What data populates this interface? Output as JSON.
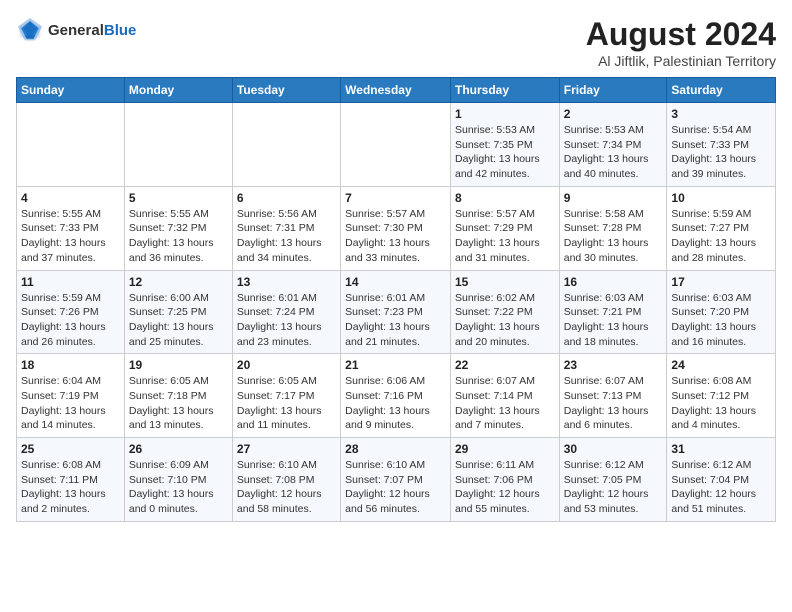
{
  "logo": {
    "text_general": "General",
    "text_blue": "Blue"
  },
  "title": "August 2024",
  "subtitle": "Al Jiftlik, Palestinian Territory",
  "days_of_week": [
    "Sunday",
    "Monday",
    "Tuesday",
    "Wednesday",
    "Thursday",
    "Friday",
    "Saturday"
  ],
  "weeks": [
    [
      {
        "day": "",
        "info": ""
      },
      {
        "day": "",
        "info": ""
      },
      {
        "day": "",
        "info": ""
      },
      {
        "day": "",
        "info": ""
      },
      {
        "day": "1",
        "info": "Sunrise: 5:53 AM\nSunset: 7:35 PM\nDaylight: 13 hours\nand 42 minutes."
      },
      {
        "day": "2",
        "info": "Sunrise: 5:53 AM\nSunset: 7:34 PM\nDaylight: 13 hours\nand 40 minutes."
      },
      {
        "day": "3",
        "info": "Sunrise: 5:54 AM\nSunset: 7:33 PM\nDaylight: 13 hours\nand 39 minutes."
      }
    ],
    [
      {
        "day": "4",
        "info": "Sunrise: 5:55 AM\nSunset: 7:33 PM\nDaylight: 13 hours\nand 37 minutes."
      },
      {
        "day": "5",
        "info": "Sunrise: 5:55 AM\nSunset: 7:32 PM\nDaylight: 13 hours\nand 36 minutes."
      },
      {
        "day": "6",
        "info": "Sunrise: 5:56 AM\nSunset: 7:31 PM\nDaylight: 13 hours\nand 34 minutes."
      },
      {
        "day": "7",
        "info": "Sunrise: 5:57 AM\nSunset: 7:30 PM\nDaylight: 13 hours\nand 33 minutes."
      },
      {
        "day": "8",
        "info": "Sunrise: 5:57 AM\nSunset: 7:29 PM\nDaylight: 13 hours\nand 31 minutes."
      },
      {
        "day": "9",
        "info": "Sunrise: 5:58 AM\nSunset: 7:28 PM\nDaylight: 13 hours\nand 30 minutes."
      },
      {
        "day": "10",
        "info": "Sunrise: 5:59 AM\nSunset: 7:27 PM\nDaylight: 13 hours\nand 28 minutes."
      }
    ],
    [
      {
        "day": "11",
        "info": "Sunrise: 5:59 AM\nSunset: 7:26 PM\nDaylight: 13 hours\nand 26 minutes."
      },
      {
        "day": "12",
        "info": "Sunrise: 6:00 AM\nSunset: 7:25 PM\nDaylight: 13 hours\nand 25 minutes."
      },
      {
        "day": "13",
        "info": "Sunrise: 6:01 AM\nSunset: 7:24 PM\nDaylight: 13 hours\nand 23 minutes."
      },
      {
        "day": "14",
        "info": "Sunrise: 6:01 AM\nSunset: 7:23 PM\nDaylight: 13 hours\nand 21 minutes."
      },
      {
        "day": "15",
        "info": "Sunrise: 6:02 AM\nSunset: 7:22 PM\nDaylight: 13 hours\nand 20 minutes."
      },
      {
        "day": "16",
        "info": "Sunrise: 6:03 AM\nSunset: 7:21 PM\nDaylight: 13 hours\nand 18 minutes."
      },
      {
        "day": "17",
        "info": "Sunrise: 6:03 AM\nSunset: 7:20 PM\nDaylight: 13 hours\nand 16 minutes."
      }
    ],
    [
      {
        "day": "18",
        "info": "Sunrise: 6:04 AM\nSunset: 7:19 PM\nDaylight: 13 hours\nand 14 minutes."
      },
      {
        "day": "19",
        "info": "Sunrise: 6:05 AM\nSunset: 7:18 PM\nDaylight: 13 hours\nand 13 minutes."
      },
      {
        "day": "20",
        "info": "Sunrise: 6:05 AM\nSunset: 7:17 PM\nDaylight: 13 hours\nand 11 minutes."
      },
      {
        "day": "21",
        "info": "Sunrise: 6:06 AM\nSunset: 7:16 PM\nDaylight: 13 hours\nand 9 minutes."
      },
      {
        "day": "22",
        "info": "Sunrise: 6:07 AM\nSunset: 7:14 PM\nDaylight: 13 hours\nand 7 minutes."
      },
      {
        "day": "23",
        "info": "Sunrise: 6:07 AM\nSunset: 7:13 PM\nDaylight: 13 hours\nand 6 minutes."
      },
      {
        "day": "24",
        "info": "Sunrise: 6:08 AM\nSunset: 7:12 PM\nDaylight: 13 hours\nand 4 minutes."
      }
    ],
    [
      {
        "day": "25",
        "info": "Sunrise: 6:08 AM\nSunset: 7:11 PM\nDaylight: 13 hours\nand 2 minutes."
      },
      {
        "day": "26",
        "info": "Sunrise: 6:09 AM\nSunset: 7:10 PM\nDaylight: 13 hours\nand 0 minutes."
      },
      {
        "day": "27",
        "info": "Sunrise: 6:10 AM\nSunset: 7:08 PM\nDaylight: 12 hours\nand 58 minutes."
      },
      {
        "day": "28",
        "info": "Sunrise: 6:10 AM\nSunset: 7:07 PM\nDaylight: 12 hours\nand 56 minutes."
      },
      {
        "day": "29",
        "info": "Sunrise: 6:11 AM\nSunset: 7:06 PM\nDaylight: 12 hours\nand 55 minutes."
      },
      {
        "day": "30",
        "info": "Sunrise: 6:12 AM\nSunset: 7:05 PM\nDaylight: 12 hours\nand 53 minutes."
      },
      {
        "day": "31",
        "info": "Sunrise: 6:12 AM\nSunset: 7:04 PM\nDaylight: 12 hours\nand 51 minutes."
      }
    ]
  ]
}
